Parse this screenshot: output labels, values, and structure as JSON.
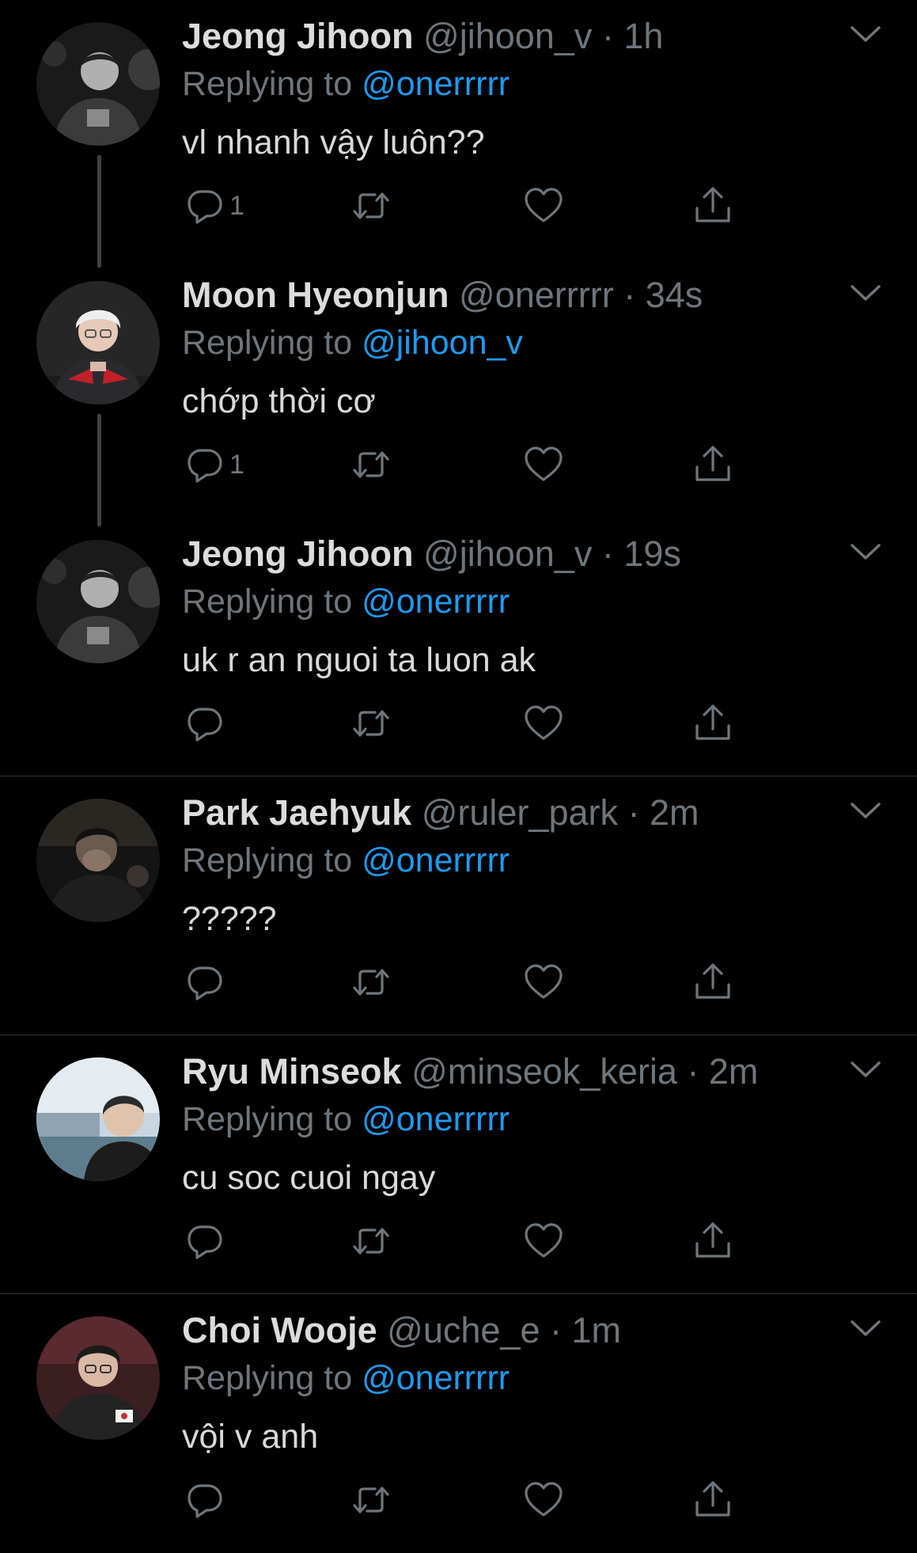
{
  "colors": {
    "background": "#000000",
    "name": "#dcdcdc",
    "muted": "#6e767d",
    "link": "#1d9bf0",
    "divider": "#2f3336"
  },
  "icons": {
    "reply": "speech-bubble-icon",
    "retweet": "retweet-icon",
    "like": "heart-icon",
    "share": "share-icon",
    "more": "chevron-down-icon"
  },
  "tweets": [
    {
      "name": "Jeong Jihoon",
      "handle": "@jihoon_v",
      "time": "1h",
      "replying_prefix": "Replying to",
      "replying_handle": "@onerrrrr",
      "text": "vl nhanh vậy luôn??",
      "reply_count": "1",
      "thread_below": true
    },
    {
      "name": "Moon Hyeonjun",
      "handle": "@onerrrrr",
      "time": "34s",
      "replying_prefix": "Replying to",
      "replying_handle": "@jihoon_v",
      "text": "chớp thời cơ",
      "reply_count": "1",
      "thread_below": true
    },
    {
      "name": "Jeong Jihoon",
      "handle": "@jihoon_v",
      "time": "19s",
      "replying_prefix": "Replying to",
      "replying_handle": "@onerrrrr",
      "text": "uk r an nguoi ta luon ak",
      "reply_count": "",
      "thread_below": false
    },
    {
      "name": "Park Jaehyuk",
      "handle": "@ruler_park",
      "time": "2m",
      "replying_prefix": "Replying to",
      "replying_handle": "@onerrrrr",
      "text": "?????",
      "reply_count": "",
      "thread_below": false
    },
    {
      "name": "Ryu Minseok",
      "handle": "@minseok_keria",
      "time": "2m",
      "replying_prefix": "Replying to",
      "replying_handle": "@onerrrrr",
      "text": "cu soc cuoi ngay",
      "reply_count": "",
      "thread_below": false
    },
    {
      "name": "Choi Wooje",
      "handle": "@uche_e",
      "time": "1m",
      "replying_prefix": "Replying to",
      "replying_handle": "@onerrrrr",
      "text": "vội v anh",
      "reply_count": "",
      "thread_below": false
    }
  ]
}
